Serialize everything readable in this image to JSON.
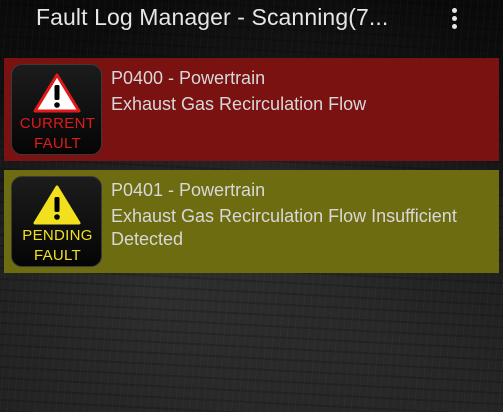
{
  "app_bar": {
    "title": "Fault Log Manager - Scanning(7...",
    "menu_icon": "more-vert-icon"
  },
  "faults": [
    {
      "code": "P0400 - Powertrain",
      "description": "Exhaust Gas Recirculation Flow",
      "badge_line1": "CURRENT",
      "badge_line2": "FAULT",
      "badge_icon": "warning-triangle-icon",
      "row_color": "#7a1212",
      "badge_text_color": "#e01a1a"
    },
    {
      "code": "P0401 - Powertrain",
      "description": "Exhaust Gas Recirculation Flow Insufficient Detected",
      "badge_line1": "PENDING",
      "badge_line2": "FAULT",
      "badge_icon": "warning-triangle-icon",
      "row_color": "#6e6c10",
      "badge_text_color": "#f2e01e"
    }
  ]
}
